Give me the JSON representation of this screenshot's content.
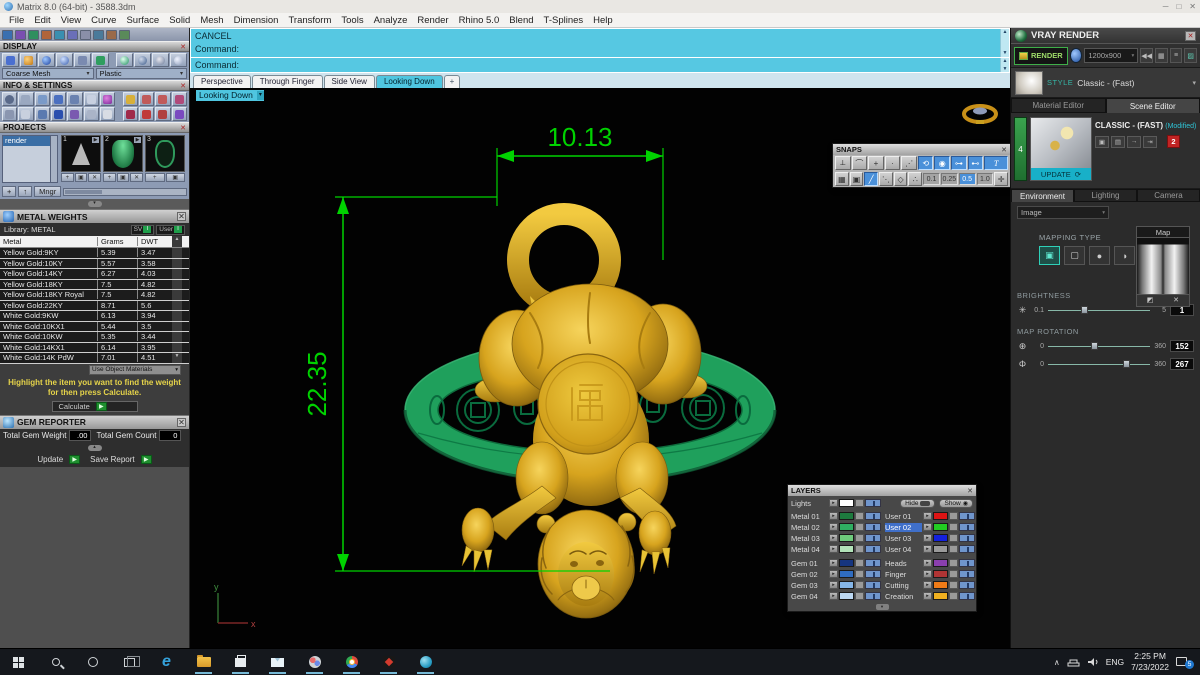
{
  "window": {
    "title": "Matrix 8.0 (64-bit) - 3588.3dm",
    "minimize": "─",
    "maximize": "□",
    "close": "✕"
  },
  "menu": {
    "items": [
      "File",
      "Edit",
      "View",
      "Curve",
      "Surface",
      "Solid",
      "Mesh",
      "Dimension",
      "Transform",
      "Tools",
      "Analyze",
      "Render",
      "Rhino 5.0",
      "Blend",
      "T-Splines",
      "Help"
    ]
  },
  "command": {
    "line1": "CANCEL",
    "line2": "Command:",
    "prompt": "Command:"
  },
  "view_tabs": {
    "t0": "Perspective",
    "t1": "Through Finger",
    "t2": "Side View",
    "t3": "Looking Down",
    "add": "+"
  },
  "viewport": {
    "label": "Looking Down",
    "dim_width": "10.13",
    "dim_height": "22.35",
    "axis_x": "x",
    "axis_y": "y",
    "colors": {
      "dimension": "#00d200",
      "band_green": "#1fa05c",
      "gold": "#d7a41e"
    }
  },
  "snaps": {
    "title": "SNAPS",
    "values": [
      "0.1",
      "0.25",
      "0.5",
      "1.0"
    ]
  },
  "layers": {
    "title": "LAYERS",
    "hide": "Hide",
    "show": "Show",
    "lights": {
      "label": "Lights",
      "color": "#ffffff"
    },
    "left": [
      {
        "label": "Metal 01",
        "color": "#1d7a3e"
      },
      {
        "label": "Metal 02",
        "color": "#2fae62"
      },
      {
        "label": "Metal 03",
        "color": "#6ecb7c"
      },
      {
        "label": "Metal 04",
        "color": "#b2e3b8"
      },
      {
        "label": "Gem 01",
        "color": "#16357f"
      },
      {
        "label": "Gem 02",
        "color": "#2f6cc0"
      },
      {
        "label": "Gem 03",
        "color": "#85b6e8"
      },
      {
        "label": "Gem 04",
        "color": "#bcd8f2"
      }
    ],
    "right": [
      {
        "label": "User 01",
        "color": "#dd1414"
      },
      {
        "label": "User 02",
        "color": "#22cc22"
      },
      {
        "label": "User 03",
        "color": "#1421dd"
      },
      {
        "label": "User 04",
        "color": "#9a9a9a"
      },
      {
        "label": "Heads",
        "color": "#8a3fae"
      },
      {
        "label": "Finger",
        "color": "#b03434"
      },
      {
        "label": "Cutting",
        "color": "#ef7b17"
      },
      {
        "label": "Creation",
        "color": "#efb020"
      }
    ]
  },
  "display": {
    "title": "DISPLAY",
    "mesh": "Coarse Mesh",
    "material": "Plastic"
  },
  "info": {
    "title": "INFO & SETTINGS"
  },
  "projects": {
    "title": "PROJECTS",
    "item": "render",
    "thumb1": "1",
    "thumb2": "2",
    "thumb3": "3",
    "add": "+",
    "up": "↑",
    "mngr": "Mngr"
  },
  "metal_weights": {
    "title": "METAL WEIGHTS",
    "library": "Library: METAL",
    "sv": "SV",
    "user": "User",
    "cols": [
      "Metal",
      "Grams",
      "DWT"
    ],
    "rows": [
      [
        "Yellow Gold:9KY",
        "5.39",
        "3.47"
      ],
      [
        "Yellow Gold:10KY",
        "5.57",
        "3.58"
      ],
      [
        "Yellow Gold:14KY",
        "6.27",
        "4.03"
      ],
      [
        "Yellow Gold:18KY",
        "7.5",
        "4.82"
      ],
      [
        "Yellow Gold:18KY Royal",
        "7.5",
        "4.82"
      ],
      [
        "Yellow Gold:22KY",
        "8.71",
        "5.6"
      ],
      [
        "White Gold:9KW",
        "6.13",
        "3.94"
      ],
      [
        "White Gold:10KX1",
        "5.44",
        "3.5"
      ],
      [
        "White Gold:10KW",
        "5.35",
        "3.44"
      ],
      [
        "White Gold:14KX1",
        "6.14",
        "3.95"
      ],
      [
        "White Gold:14K PdW",
        "7.01",
        "4.51"
      ]
    ],
    "materials_dropdown": "Use Object Materials",
    "hint1": "Highlight the item you want to find the weight",
    "hint2": "for then press Calculate.",
    "calculate": "Calculate"
  },
  "gem_reporter": {
    "title": "GEM REPORTER",
    "weight_label": "Total Gem Weight",
    "weight_value": ".00",
    "count_label": "Total Gem Count",
    "count_value": "0",
    "update": "Update",
    "save": "Save Report"
  },
  "vray": {
    "title": "VRAY RENDER",
    "render": "RENDER",
    "resolution": "1200x900",
    "style_label": "STYLE",
    "style_value": "Classic - (Fast)",
    "tab_material": "Material Editor",
    "tab_scene": "Scene Editor",
    "scene_index": "4",
    "scene_name": "CLASSIC - (FAST)",
    "modified": "(Modified)",
    "update": "UPDATE",
    "badge": "2",
    "tab_env": "Environment",
    "tab_light": "Lighting",
    "tab_cam": "Camera",
    "env_source": "Image",
    "mapping_label": "MAPPING TYPE",
    "map_title": "Map",
    "brightness_label": "BRIGHTNESS",
    "brightness": {
      "min": "0.1",
      "max": "5",
      "value": "1"
    },
    "rotation_label": "MAP ROTATION",
    "rot1": {
      "min": "0",
      "max": "360",
      "value": "152"
    },
    "rot2": {
      "min": "0",
      "max": "360",
      "value": "267"
    }
  },
  "taskbar": {
    "lang": "ENG",
    "time": "2:25 PM",
    "date": "7/23/2022",
    "badge": "5"
  }
}
